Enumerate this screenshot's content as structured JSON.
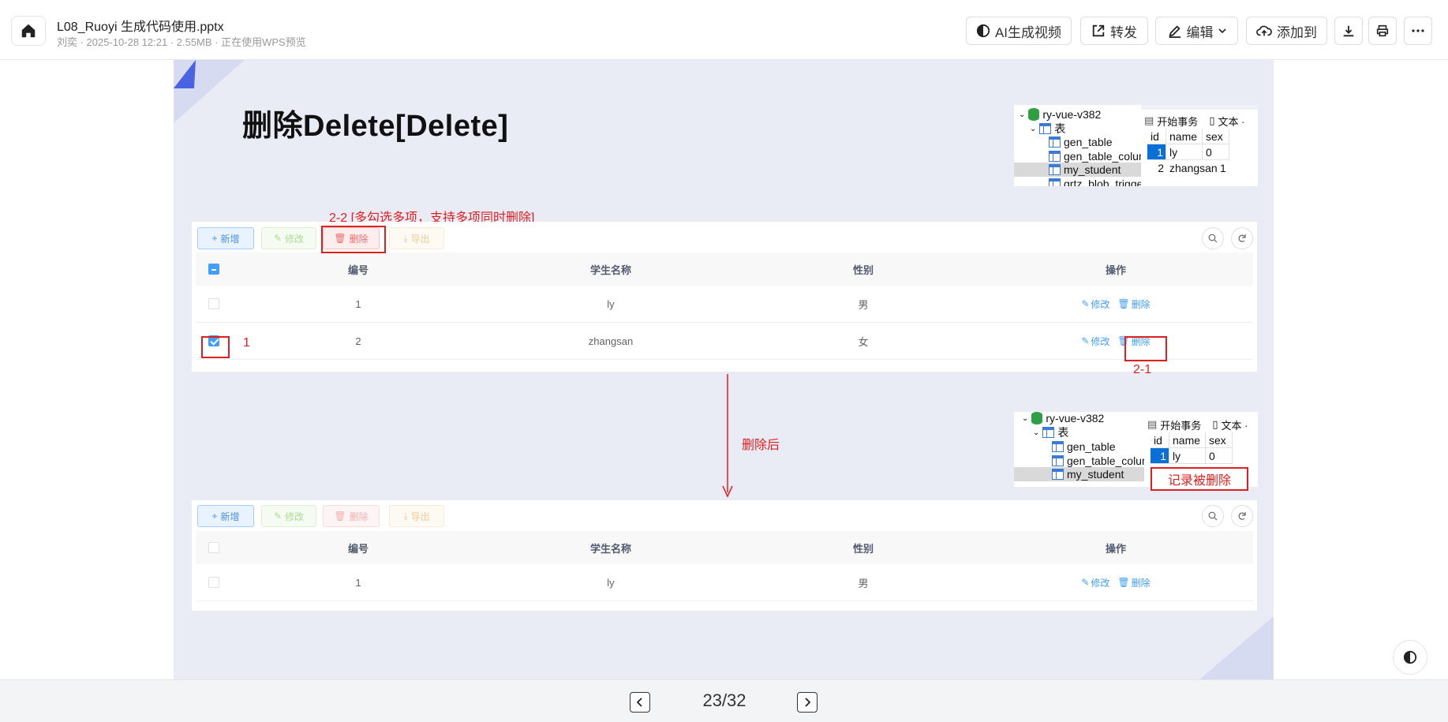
{
  "header": {
    "title": "L08_Ruoyi 生成代码使用.pptx",
    "meta": "刘奕 · 2025-10-28 12:21 · 2.55MB · 正在使用WPS预览",
    "ai_video_label": "AI生成视频",
    "share_label": "转发",
    "edit_label": "编辑",
    "add_to_label": "添加到"
  },
  "slide": {
    "title": "删除Delete[Delete]",
    "db_tree_top": {
      "db_name": "ry-vue-v382",
      "folder": "表",
      "tables": [
        "gen_table",
        "gen_table_column",
        "my_student",
        "qrtz_blob_triggers"
      ]
    },
    "grid_top": {
      "tabs": [
        "开始事务",
        "文本 ·"
      ],
      "headers": [
        "id",
        "name",
        "sex"
      ],
      "rows": [
        [
          "1",
          "ly",
          "0"
        ],
        [
          "2",
          "zhangsan",
          "1"
        ]
      ]
    },
    "annot_multi": "2-2 [多勾选多项，支持多项同时删除]",
    "annot_one": "1",
    "annot_two_one": "2-1",
    "annot_after": "删除后",
    "annot_deleted": "记录被删除",
    "db_tree_bottom": {
      "db_name": "ry-vue-v382",
      "folder": "表",
      "tables": [
        "gen_table",
        "gen_table_column",
        "my_student"
      ]
    },
    "grid_bottom": {
      "tabs": [
        "开始事务",
        "文本 ·"
      ],
      "headers": [
        "id",
        "name",
        "sex"
      ],
      "rows": [
        [
          "1",
          "ly",
          "0"
        ]
      ]
    },
    "toolbar": {
      "add": "新增",
      "edit": "修改",
      "delete": "删除",
      "export": "导出"
    },
    "table_headers": [
      "编号",
      "学生名称",
      "性别",
      "操作"
    ],
    "table_top_rows": [
      {
        "id": "1",
        "name": "ly",
        "sex": "男",
        "edit": "修改",
        "del": "删除"
      },
      {
        "id": "2",
        "name": "zhangsan",
        "sex": "女",
        "edit": "修改",
        "del": "删除"
      }
    ],
    "table_bottom_rows": [
      {
        "id": "1",
        "name": "ly",
        "sex": "男",
        "edit": "修改",
        "del": "删除"
      }
    ]
  },
  "pager": {
    "text": "23/32"
  },
  "colors": {
    "accent": "#409eff",
    "annotation": "#e02020",
    "slide_bg": "#e9ebf5"
  }
}
